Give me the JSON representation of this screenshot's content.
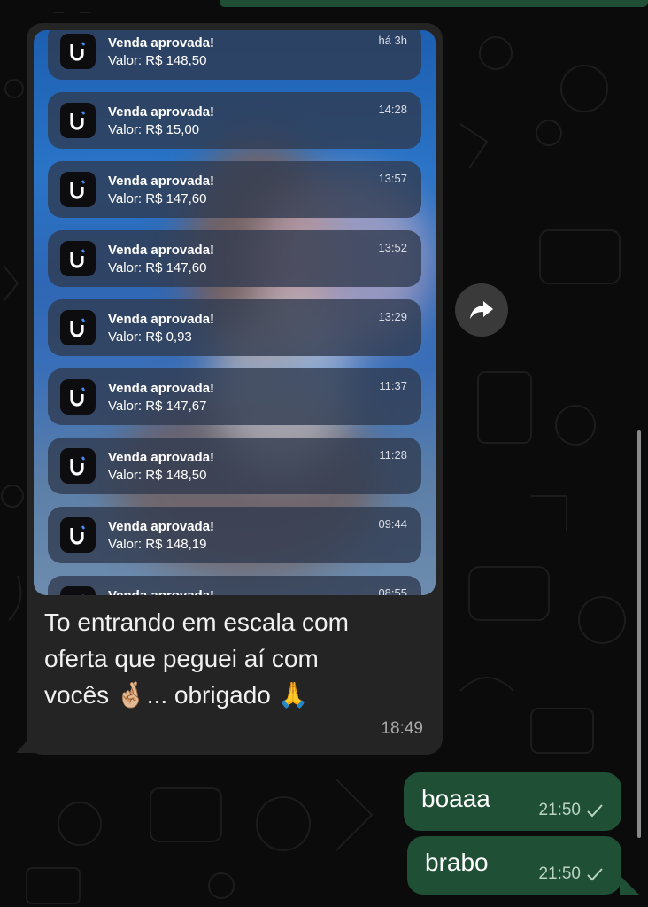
{
  "notifications": [
    {
      "title": "Venda aprovada!",
      "value": "Valor: R$ 148,50",
      "time": "há 3h"
    },
    {
      "title": "Venda aprovada!",
      "value": "Valor: R$ 15,00",
      "time": "14:28"
    },
    {
      "title": "Venda aprovada!",
      "value": "Valor: R$ 147,60",
      "time": "13:57"
    },
    {
      "title": "Venda aprovada!",
      "value": "Valor: R$ 147,60",
      "time": "13:52"
    },
    {
      "title": "Venda aprovada!",
      "value": "Valor: R$ 0,93",
      "time": "13:29"
    },
    {
      "title": "Venda aprovada!",
      "value": "Valor: R$ 147,67",
      "time": "11:37"
    },
    {
      "title": "Venda aprovada!",
      "value": "Valor: R$ 148,50",
      "time": "11:28"
    },
    {
      "title": "Venda aprovada!",
      "value": "Valor: R$ 148,19",
      "time": "09:44"
    },
    {
      "title": "Venda aprovada!",
      "value": "",
      "time": "08:55"
    }
  ],
  "incoming": {
    "line1": "To entrando em escala com",
    "line2": "oferta que peguei aí com",
    "line3": "vocês 🤞🏼... obrigado 🙏",
    "time": "18:49"
  },
  "outgoing": [
    {
      "text": "boaaa",
      "time": "21:50",
      "status_icon": "single-check-icon"
    },
    {
      "text": "brabo",
      "time": "21:50",
      "status_icon": "single-check-icon"
    }
  ],
  "colors": {
    "outgoing_bubble": "#1f4f35",
    "incoming_bubble": "#242424",
    "background": "#0b0b0b"
  }
}
